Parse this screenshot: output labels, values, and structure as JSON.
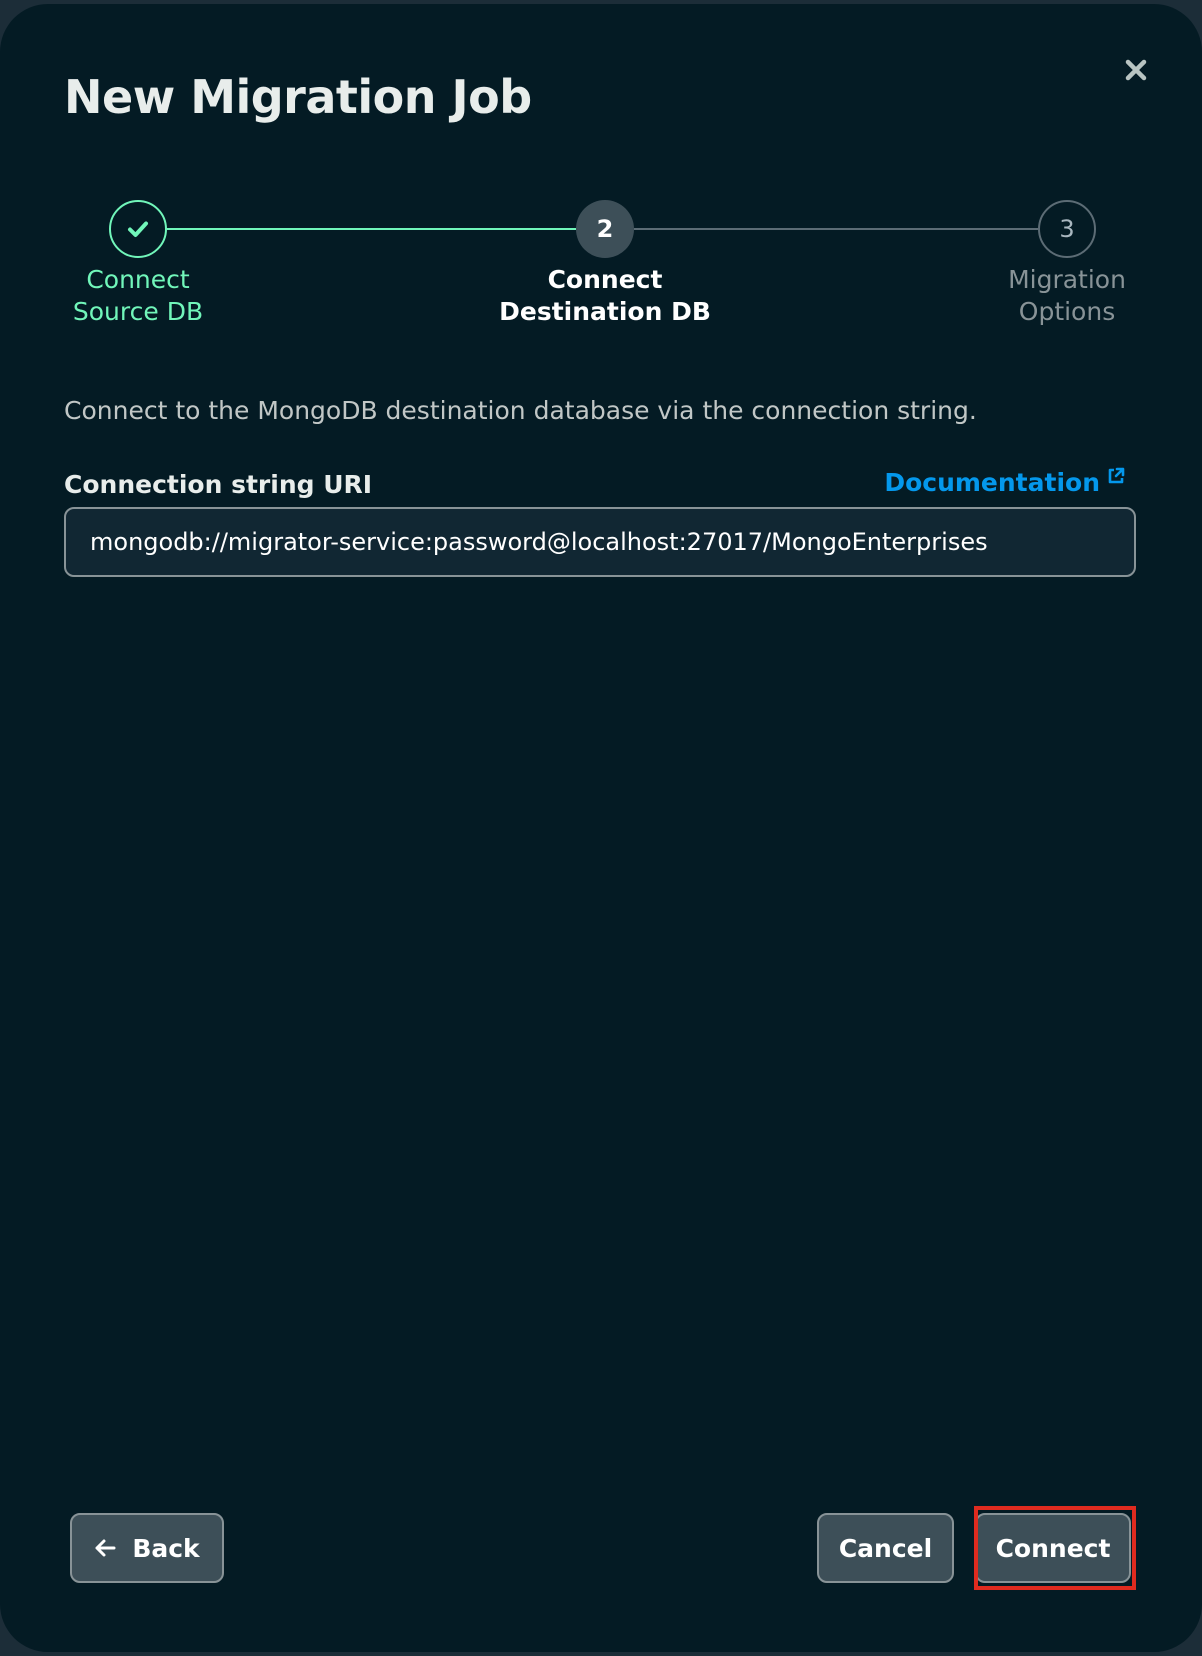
{
  "dialog": {
    "title": "New Migration Job"
  },
  "stepper": {
    "steps": [
      {
        "label_line1": "Connect",
        "label_line2": "Source DB",
        "state": "completed",
        "icon": "check-icon"
      },
      {
        "number": "2",
        "label_line1": "Connect",
        "label_line2": "Destination DB",
        "state": "active"
      },
      {
        "number": "3",
        "label_line1": "Migration",
        "label_line2": "Options",
        "state": "pending"
      }
    ]
  },
  "form": {
    "description": "Connect to the MongoDB destination database via the connection string.",
    "field_label": "Connection string URI",
    "doc_link_label": "Documentation",
    "uri_value": "mongodb://migrator-service:password@localhost:27017/MongoEnterprises"
  },
  "footer": {
    "back_label": "Back",
    "cancel_label": "Cancel",
    "connect_label": "Connect"
  },
  "colors": {
    "background": "#041b24",
    "completed": "#71f6ba",
    "link": "#0498ec",
    "highlight": "#e02b1f"
  }
}
